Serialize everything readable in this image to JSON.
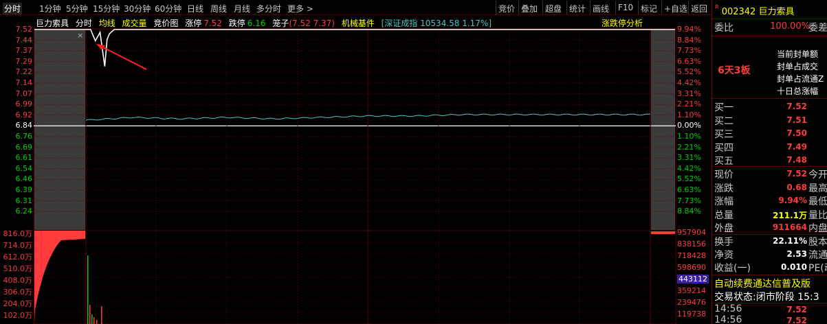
{
  "toolbar": {
    "tabs": [
      "分时",
      "1分钟",
      "5分钟",
      "15分钟",
      "30分钟",
      "60分钟",
      "日线",
      "周线",
      "月线",
      "多分时",
      "更多 >"
    ],
    "active_tab": "分时",
    "buttons": [
      "竞价",
      "叠加",
      "超盘",
      "统计",
      "画线",
      "F10",
      "标记",
      "+自选",
      "返回"
    ]
  },
  "info_bar": {
    "name": "巨力索具",
    "mode": "分时",
    "avg_line": "均线",
    "volume": "成交量",
    "auction": "竞价图",
    "limit_up_label": "涨停",
    "limit_up_value": "7.52",
    "limit_down_label": "跌停",
    "limit_down_value": "6.16",
    "pen_label": "笼子",
    "pen_value": "(7.52 7.37)",
    "sector": "机械基件",
    "index": "[深证成指 10534.58 1.17%]",
    "analysis": "涨跌停分析",
    "close_glyph": "×"
  },
  "price_axis": {
    "left": [
      "7.52",
      "7.44",
      "7.37",
      "7.29",
      "7.22",
      "7.14",
      "7.07",
      "6.99",
      "6.92",
      "6.84",
      "6.76",
      "6.69",
      "6.61",
      "6.54",
      "6.46",
      "6.39",
      "6.31",
      "6.24"
    ],
    "right": [
      "9.94%",
      "8.84%",
      "7.73%",
      "6.63%",
      "5.52%",
      "4.42%",
      "3.31%",
      "2.21%",
      "1.10%",
      "0.00%",
      "1.10%",
      "2.21%",
      "3.31%",
      "4.42%",
      "5.52%",
      "6.63%",
      "7.73%",
      "8.84%"
    ]
  },
  "volume_axis": {
    "left": [
      "816.0万",
      "714.0万",
      "612.0万",
      "510.0万",
      "408.0万",
      "306.0万",
      "204.0万",
      "102.0万"
    ],
    "right": [
      "957904",
      "838156",
      "718428",
      "598690",
      "443112",
      "359214",
      "239476",
      "119738"
    ],
    "highlight_right": "443112"
  },
  "chart_data": {
    "type": "line",
    "title": "",
    "prev_close": 6.84,
    "ylim": [
      6.16,
      7.52
    ],
    "series": [
      {
        "name": "分时",
        "x_index": [
          0,
          2,
          4,
          6,
          8,
          9,
          10,
          12,
          14,
          16,
          20,
          240
        ],
        "values": [
          7.52,
          7.52,
          7.44,
          7.5,
          7.26,
          7.45,
          7.49,
          7.52,
          7.52,
          7.52,
          7.52,
          7.52
        ]
      },
      {
        "name": "均线",
        "x_index": [
          0,
          20,
          40,
          60,
          80,
          100,
          120,
          140,
          160,
          180,
          200,
          220,
          240
        ],
        "values": [
          6.88,
          6.9,
          6.89,
          6.9,
          6.89,
          6.9,
          6.91,
          6.91,
          6.92,
          6.92,
          6.92,
          6.92,
          6.92
        ]
      }
    ],
    "volume_ylim": [
      0,
      8160000
    ]
  },
  "panel": {
    "code": "002342",
    "name": "巨力索具",
    "ratio_label": "委比",
    "ratio_value": "100.00%",
    "ratio_right": "委差",
    "board_days": "6天3板",
    "seal_info": [
      "当前封单额",
      "封单占成交",
      "封单占流通Z",
      "十日总涨幅"
    ],
    "bids": [
      {
        "label": "买一",
        "price": "7.52"
      },
      {
        "label": "买二",
        "price": "7.51"
      },
      {
        "label": "买三",
        "price": "7.50"
      },
      {
        "label": "买四",
        "price": "7.49"
      },
      {
        "label": "买五",
        "price": "7.48"
      }
    ],
    "quote": [
      {
        "label": "现价",
        "value": "7.52",
        "right": "今开",
        "color": "#ff3b3b"
      },
      {
        "label": "涨跌",
        "value": "0.68",
        "right": "最高",
        "color": "#ff3b3b"
      },
      {
        "label": "涨幅",
        "value": "9.94%",
        "right": "最低",
        "color": "#ff3b3b"
      },
      {
        "label": "总量",
        "value": "211.1万",
        "right": "量比",
        "color": "#ffff00"
      },
      {
        "label": "外盘",
        "value": "911664",
        "right": "内盘",
        "color": "#ff3b3b"
      }
    ],
    "fundamentals": [
      {
        "label": "换手",
        "value": "22.11%",
        "right": "股本"
      },
      {
        "label": "净资",
        "value": "2.53",
        "right": "流通"
      },
      {
        "label": "收益(一)",
        "value": "0.010",
        "right": "PE(动"
      }
    ],
    "banner": "自动续费通达信普及版",
    "status_label": "交易状态:",
    "status_value": "闭市阶段",
    "status_time": "15:3",
    "ticks": [
      {
        "time": "14:56",
        "price": "7.52"
      },
      {
        "time": "14:56",
        "price": "7.52"
      }
    ]
  },
  "colors": {
    "up": "#ff3b3b",
    "down": "#00d000",
    "grid": "#5a0000",
    "price_line": "#ffffff",
    "avg_line": "#4fc3c3",
    "accent_yellow": "#ffff00"
  }
}
